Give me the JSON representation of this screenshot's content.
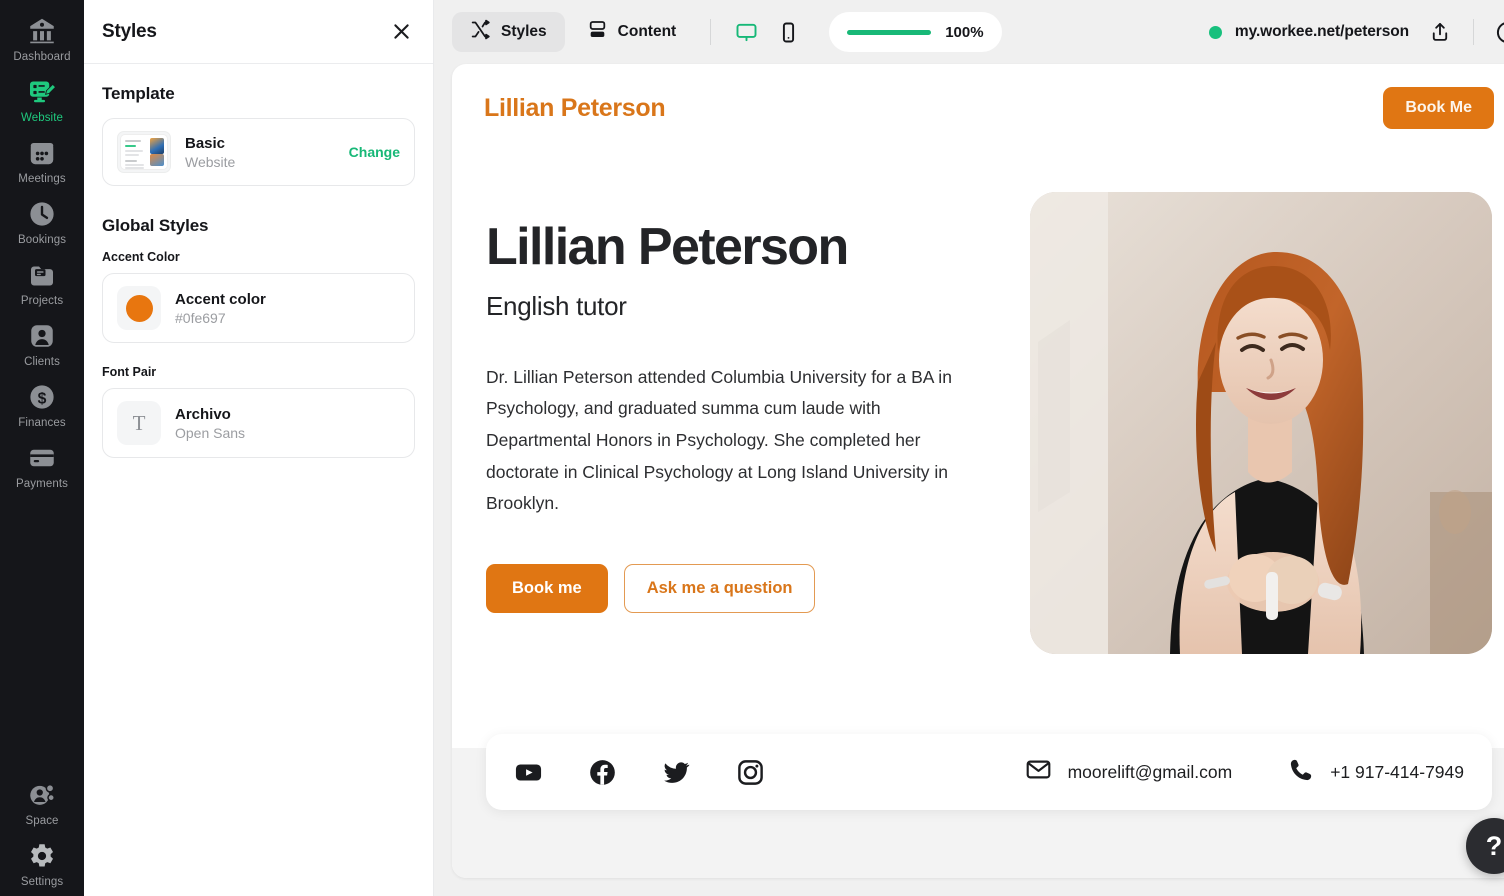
{
  "sidebar": {
    "items": [
      {
        "label": "Dashboard",
        "icon": "dashboard-icon",
        "active": false
      },
      {
        "label": "Website",
        "icon": "website-icon",
        "active": true
      },
      {
        "label": "Meetings",
        "icon": "meetings-icon",
        "active": false
      },
      {
        "label": "Bookings",
        "icon": "bookings-clock-icon",
        "active": false
      },
      {
        "label": "Projects",
        "icon": "projects-folder-icon",
        "active": false
      },
      {
        "label": "Clients",
        "icon": "clients-person-icon",
        "active": false
      },
      {
        "label": "Finances",
        "icon": "finances-dollar-icon",
        "active": false
      },
      {
        "label": "Payments",
        "icon": "payments-card-icon",
        "active": false
      }
    ],
    "bottom_items": [
      {
        "label": "Space",
        "icon": "space-people-icon"
      },
      {
        "label": "Settings",
        "icon": "settings-gear-icon"
      }
    ],
    "active_color": "#1fc97e",
    "bg_color": "#15161a"
  },
  "panel": {
    "title": "Styles",
    "close_icon": "close-icon",
    "template": {
      "heading": "Template",
      "name": "Basic",
      "subtitle": "Website",
      "action": "Change",
      "action_color": "#17b877"
    },
    "global_styles": {
      "heading": "Global Styles",
      "accent": {
        "label": "Accent Color",
        "name": "Accent color",
        "value": "#0fe697",
        "swatch_color": "#e8760f"
      },
      "font_pair": {
        "label": "Font Pair",
        "name": "Archivo",
        "subtitle": "Open Sans",
        "glyph": "T"
      }
    }
  },
  "toolbar": {
    "tabs": [
      {
        "label": "Styles",
        "icon": "styles-shuffle-icon",
        "active": true
      },
      {
        "label": "Content",
        "icon": "content-layout-icon",
        "active": false
      }
    ],
    "devices": [
      {
        "name": "desktop-icon",
        "active": true
      },
      {
        "name": "mobile-icon",
        "active": false
      }
    ],
    "zoom": {
      "value": "100%",
      "percent": 100
    },
    "url": "my.workee.net/peterson",
    "status_dot_color": "#18c07d",
    "share_icon": "share-icon",
    "help_icon": "help-circle-icon"
  },
  "preview": {
    "brand": "Lillian Peterson",
    "header_cta": "Book Me",
    "hero": {
      "title": "Lillian Peterson",
      "subtitle": "English tutor",
      "body": "Dr. Lillian Peterson attended Columbia University for a BA in Psychology, and graduated summa cum laude with Departmental Honors in Psychology. She completed her doctorate in Clinical Psychology at Long Island University in Brooklyn.",
      "primary_cta": "Book me",
      "secondary_cta": "Ask me a question",
      "photo_alt": "smiling woman with long red hair in black sleeveless top"
    },
    "footer": {
      "socials": [
        {
          "name": "youtube-icon"
        },
        {
          "name": "facebook-icon"
        },
        {
          "name": "twitter-icon"
        },
        {
          "name": "instagram-icon"
        }
      ],
      "email": "moorelift@gmail.com",
      "email_icon": "mail-icon",
      "phone": "+1 917-414-7949",
      "phone_icon": "phone-icon"
    },
    "accent_color": "#e07613"
  },
  "fab": {
    "label": "?",
    "name": "help-fab"
  }
}
